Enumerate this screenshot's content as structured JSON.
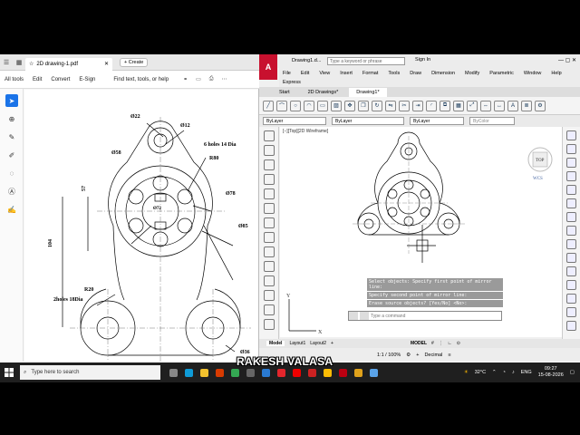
{
  "pdf": {
    "tab_title": "2D drawing-1.pdf",
    "create_label": "Create",
    "menu": [
      "All tools",
      "Edit",
      "Convert",
      "E-Sign"
    ],
    "search_text": "Find text, tools, or help",
    "drawing_labels": {
      "d22": "Ø22",
      "d12": "Ø12",
      "holes6": "6 holes 14 Dia",
      "r80": "R80",
      "d58": "Ø58",
      "d57": "57",
      "d78": "Ø78",
      "d104": "104",
      "d85": "Ø85",
      "d72": "Ø72",
      "r20": "R20",
      "holes2": "2holes 18Dia",
      "d36": "Ø36",
      "d90": "90"
    }
  },
  "cad": {
    "title": "Drawing1.d...",
    "search_placeholder": "Type a keyword or phrase",
    "signin": "Sign In",
    "menu": [
      "File",
      "Edit",
      "View",
      "Insert",
      "Format",
      "Tools",
      "Draw",
      "Dimension",
      "Modify",
      "Parametric",
      "Window",
      "Help",
      "Express"
    ],
    "tabs": [
      "Start",
      "2D Drawings*",
      "Drawing1*"
    ],
    "props": [
      "ByLayer",
      "ByLayer",
      "ByLayer",
      "ByColor"
    ],
    "view_label": "[−][Top][2D Wireframe]",
    "viewcube": "TOP",
    "ucs": "WCS",
    "cmd_history": [
      "Select objects:  Specify first point of mirror line:",
      "Specify second point of mirror line:",
      "Erase source objects? [Yes/No] <No>:"
    ],
    "cmd_placeholder": "Type a command",
    "layout_tabs": [
      "Model",
      "Layout1",
      "Layout2"
    ],
    "status_model": "MODEL",
    "scale": "1:1 / 100%",
    "units": "Decimal"
  },
  "taskbar": {
    "search_placeholder": "Type here to search",
    "temperature": "32°C",
    "lang": "ENG",
    "time": "09:27",
    "date": "15-08-2026"
  },
  "overlay": {
    "name": "RAKESH VALASA"
  }
}
